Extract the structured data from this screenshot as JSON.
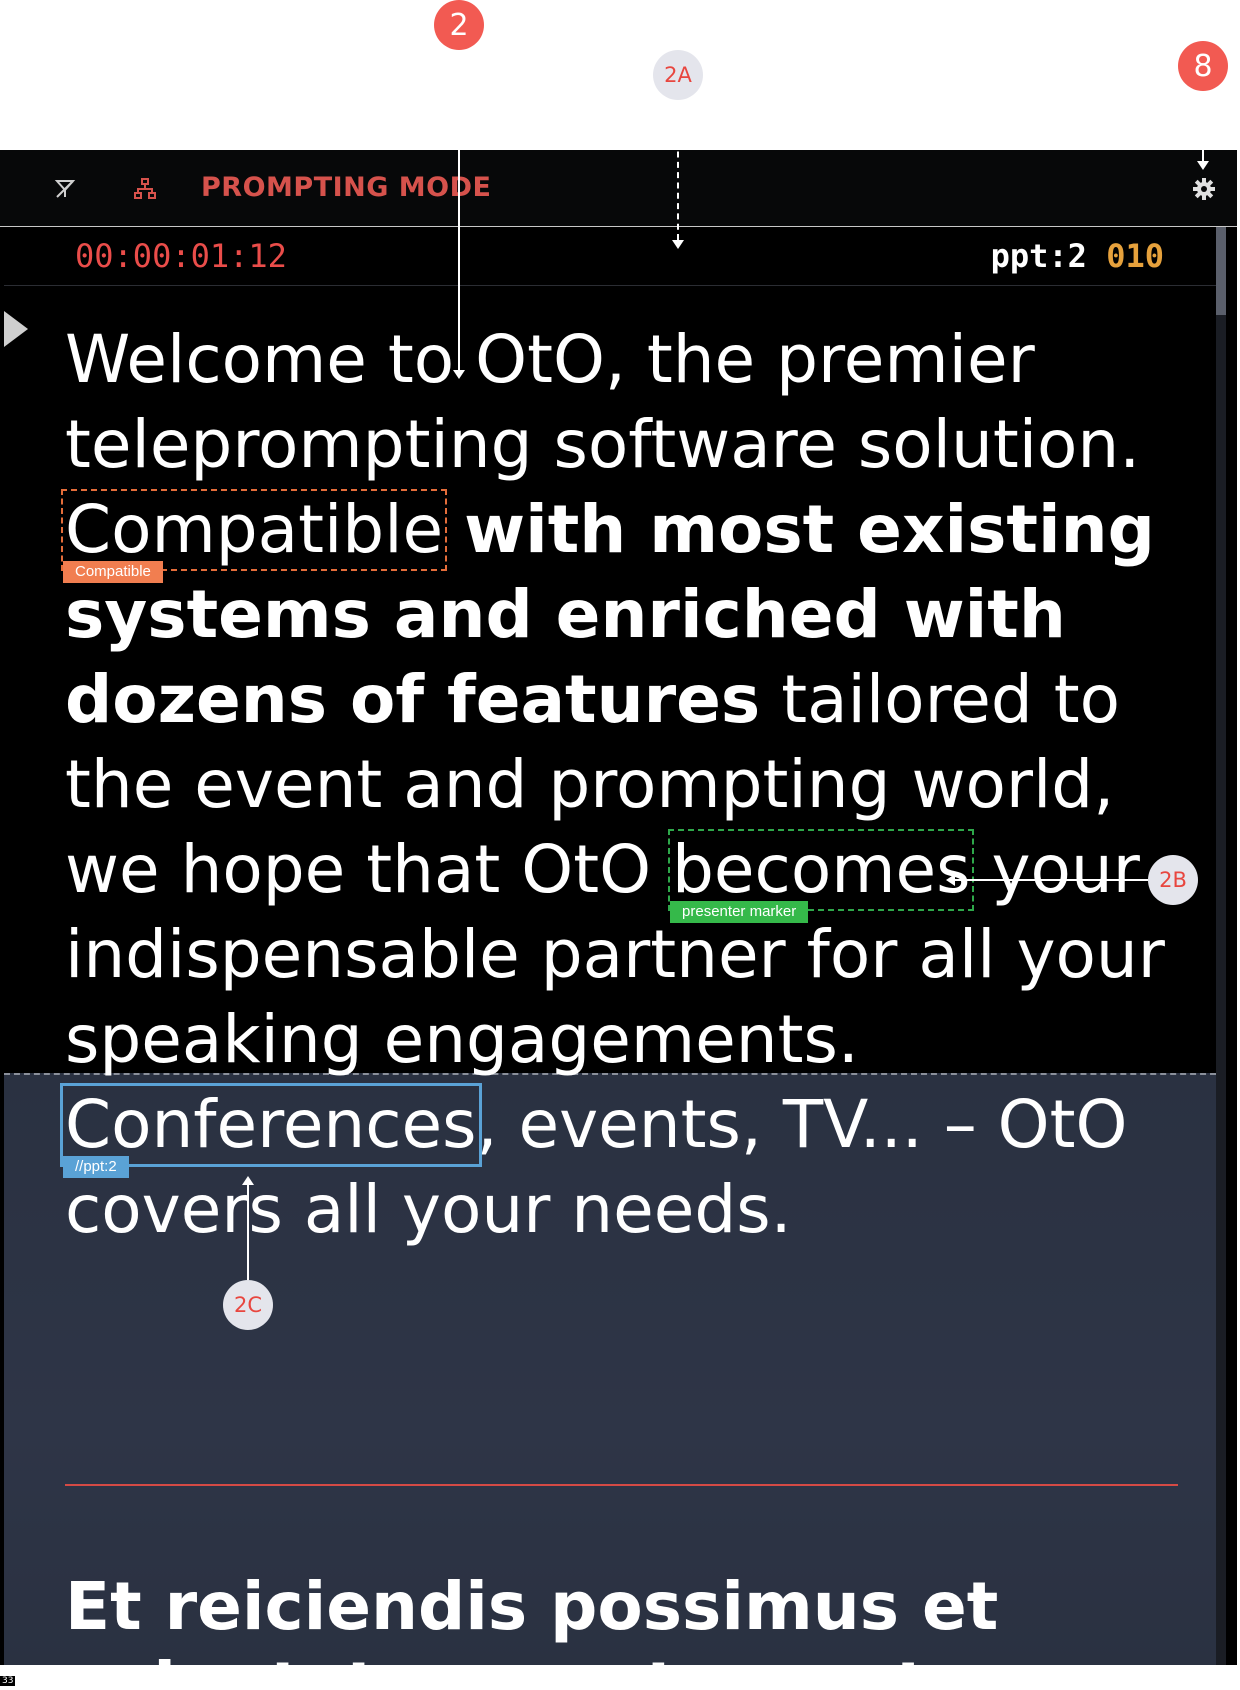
{
  "callouts": {
    "c2": "2",
    "c2a": "2A",
    "c8": "8",
    "c2b": "2B",
    "c2c": "2C"
  },
  "toolbar": {
    "mode_label": "PROMPTING MODE",
    "icons": [
      "eraser-icon",
      "sitemap-icon",
      "gear-icon"
    ]
  },
  "status": {
    "timer": "00:00:01:12",
    "ppt_label": "ppt:2",
    "ppt_count": "010"
  },
  "script": {
    "t1": "Welcome to OtO, the premier teleprompting software solution.",
    "compat_word": "Compatible",
    "compat_tag": "Compatible",
    "bold_1": "with most existing systems and enriched with dozens of features",
    "t2": "tailored to the event and prompting world,",
    "t3": "we hope that OtO",
    "presenter_word": "becomes",
    "presenter_tag": "presenter marker",
    "t4": "your indispensable partner for all your speaking engagements.",
    "ppt_word": "Conferences",
    "ppt_tag": "//ppt:2",
    "t5": ", events, TV... – OtO covers all your needs."
  },
  "next_heading": "Et reiciendis possimus et voluptatem nostrum ut",
  "version": "33",
  "colors": {
    "accent_red": "#d6524c",
    "counter_amber": "#e6a13c",
    "compat_orange": "#f17e50",
    "presenter_green": "#35b94a",
    "ppt_blue": "#5aa2d6"
  }
}
